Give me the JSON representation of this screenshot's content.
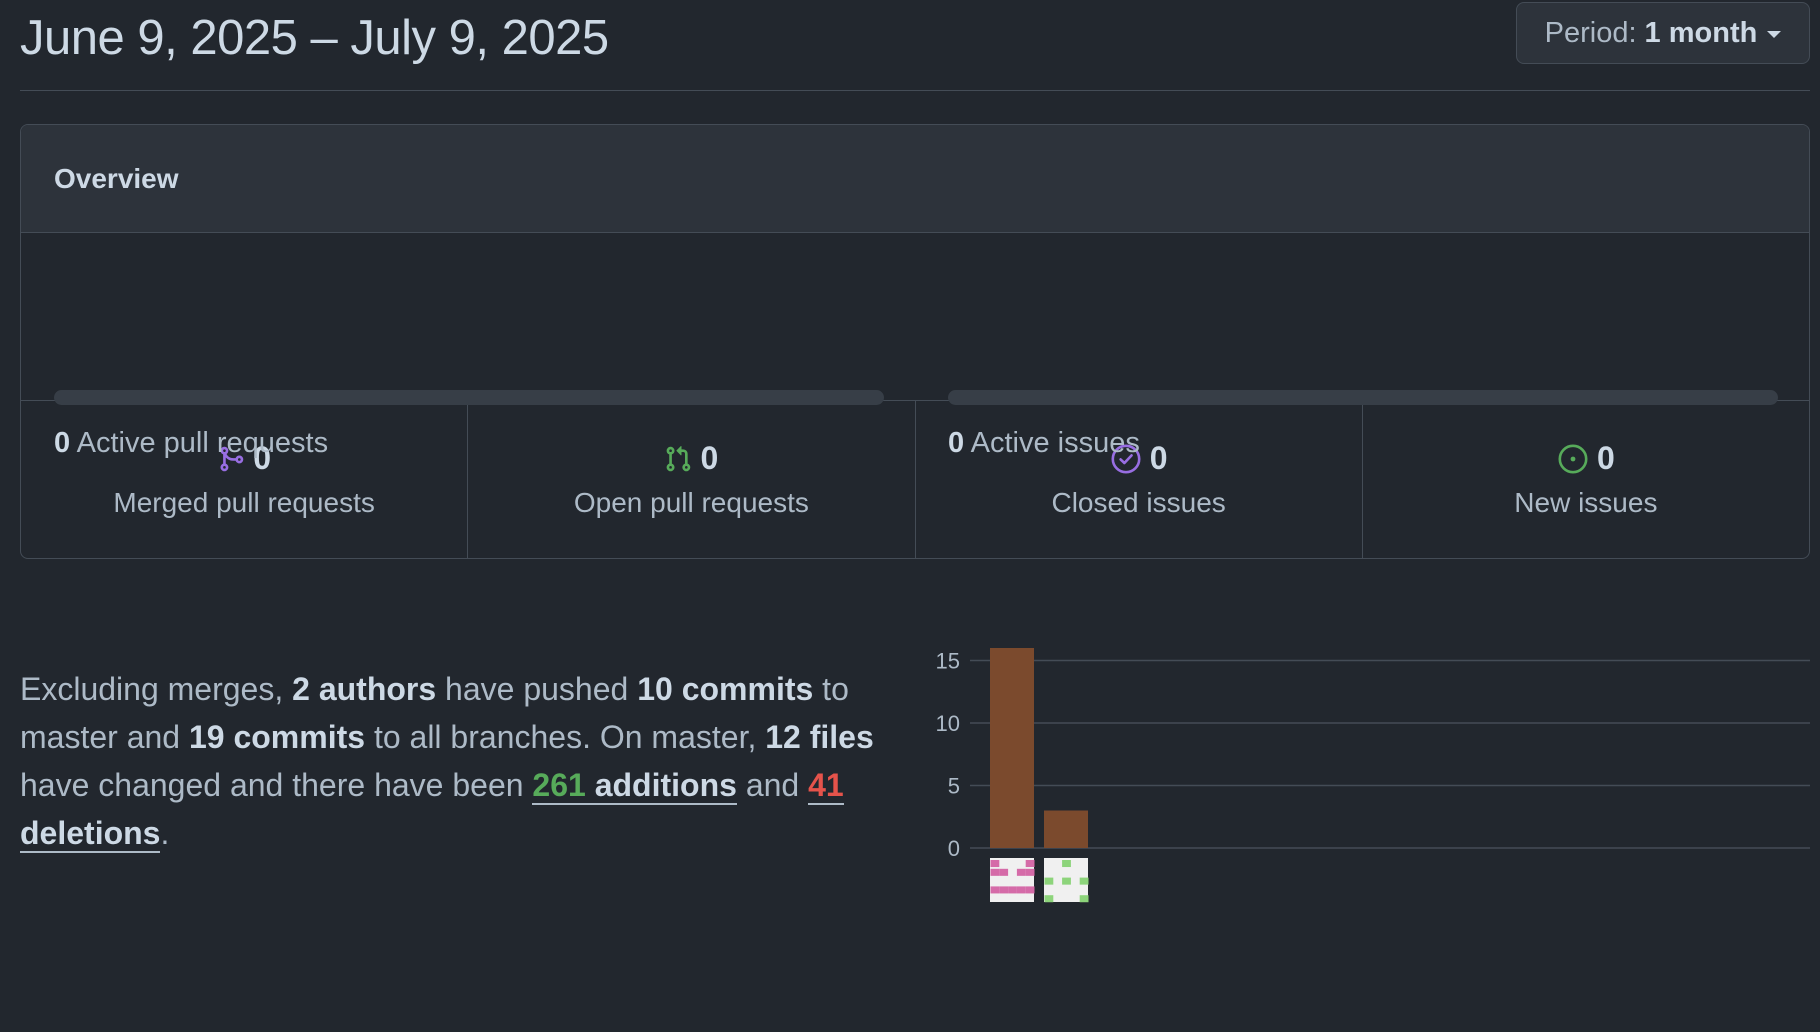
{
  "header": {
    "date_range": "June 9, 2025 – July 9, 2025",
    "period_label": "Period:",
    "period_value": "1 month"
  },
  "overview": {
    "title": "Overview",
    "active_prs": {
      "count": "0",
      "label": "Active pull requests",
      "fill": 0
    },
    "active_issues": {
      "count": "0",
      "label": "Active issues",
      "fill": 0
    },
    "stats": [
      {
        "icon": "merge-icon",
        "value": "0",
        "label": "Merged pull requests",
        "color": "#986ee2"
      },
      {
        "icon": "pull-request-icon",
        "value": "0",
        "label": "Open pull requests",
        "color": "#57ab5a"
      },
      {
        "icon": "issue-closed-icon",
        "value": "0",
        "label": "Closed issues",
        "color": "#986ee2"
      },
      {
        "icon": "issue-opened-icon",
        "value": "0",
        "label": "New issues",
        "color": "#57ab5a"
      }
    ]
  },
  "summary": {
    "part1": "Excluding merges, ",
    "authors": "2 authors",
    "part2": " have pushed ",
    "commits_master": "10 commits",
    "part3": " to master and ",
    "commits_all": "19 commits",
    "part4": " to all branches. On master, ",
    "files": "12 files",
    "part5": " have changed and there have been ",
    "additions_num": "261",
    "additions_word": " additions",
    "part6": " and ",
    "deletions_num": "41",
    "deletions_word": " deletions",
    "part7": "."
  },
  "chart_data": {
    "type": "bar",
    "categories": [
      "author-1",
      "author-2"
    ],
    "values": [
      16,
      3
    ],
    "yticks": [
      0,
      5,
      10,
      15
    ],
    "ylim": [
      0,
      16
    ],
    "bar_color": "#7b4a2d",
    "avatars": [
      {
        "icon": "identicon-pink-icon",
        "color": "#d56ba8"
      },
      {
        "icon": "identicon-green-icon",
        "color": "#8dd47b"
      }
    ]
  }
}
